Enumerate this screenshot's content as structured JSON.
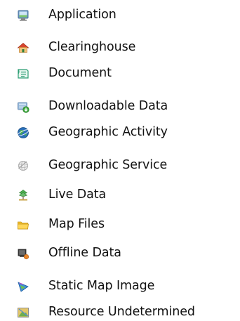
{
  "legend": {
    "items": [
      {
        "label": "Application",
        "icon": "application-icon"
      },
      {
        "label": "Clearinghouse",
        "icon": "clearinghouse-icon"
      },
      {
        "label": "Document",
        "icon": "document-icon"
      },
      {
        "label": "Downloadable Data",
        "icon": "downloadable-data-icon"
      },
      {
        "label": "Geographic Activity",
        "icon": "geographic-activity-icon"
      },
      {
        "label": "Geographic Service",
        "icon": "geographic-service-icon"
      },
      {
        "label": "Live Data",
        "icon": "live-data-icon"
      },
      {
        "label": "Map Files",
        "icon": "map-files-icon"
      },
      {
        "label": "Offline Data",
        "icon": "offline-data-icon"
      },
      {
        "label": "Static Map Image",
        "icon": "static-map-image-icon"
      },
      {
        "label": "Resource Undetermined",
        "icon": "resource-undetermined-icon"
      }
    ]
  }
}
